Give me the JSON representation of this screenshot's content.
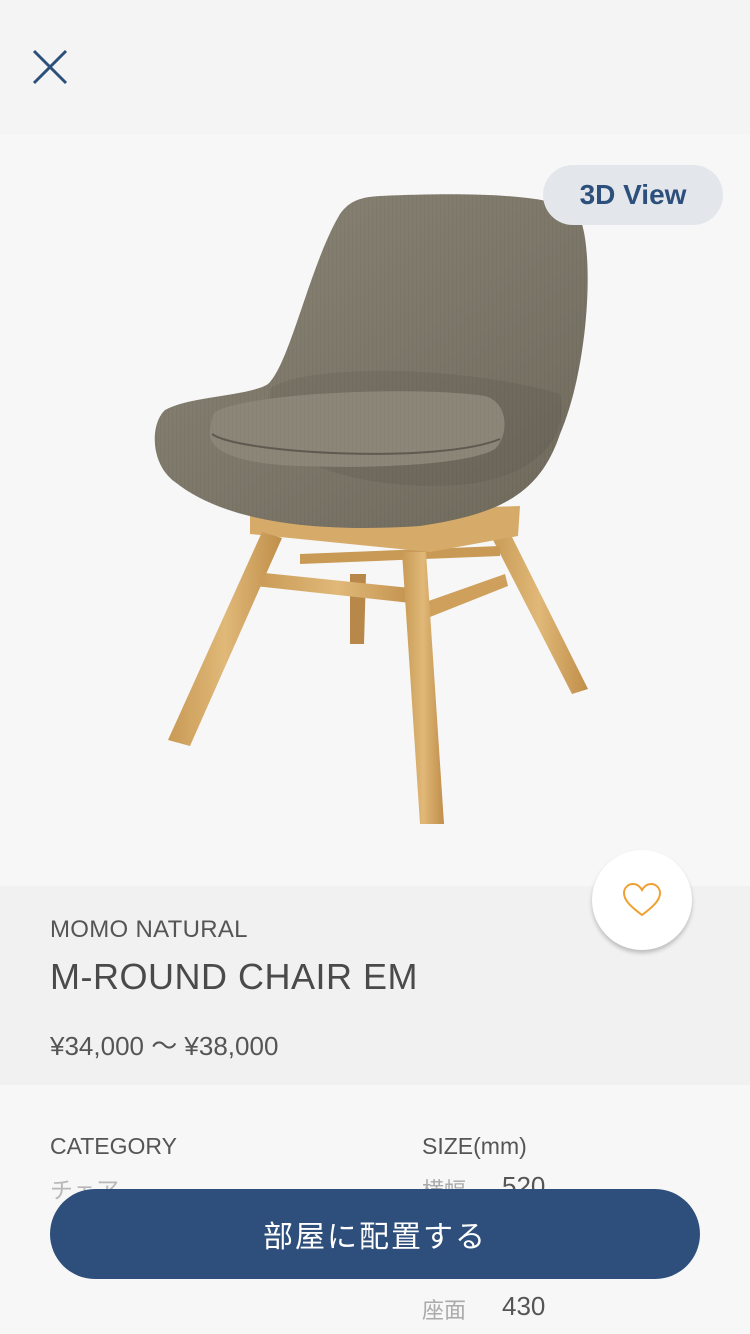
{
  "header": {
    "close_icon": "close-icon"
  },
  "hero": {
    "view3d_label": "3D View",
    "image": "chair-product-image"
  },
  "product": {
    "brand": "MOMO NATURAL",
    "name": "M-ROUND CHAIR EM",
    "price": "¥34,000 〜 ¥38,000",
    "favorite_icon": "heart-outline-icon"
  },
  "details": {
    "category_label": "CATEGORY",
    "category_value": "チェア",
    "size_label": "SIZE(mm)",
    "sizes": [
      {
        "label": "横幅",
        "value": "520"
      },
      {
        "label": "座面",
        "value": "430"
      }
    ]
  },
  "action": {
    "place_label": "部屋に配置する"
  },
  "colors": {
    "accent": "#2e4f7c",
    "heart": "#f0a030",
    "view3d_bg": "#e3e7ec"
  }
}
